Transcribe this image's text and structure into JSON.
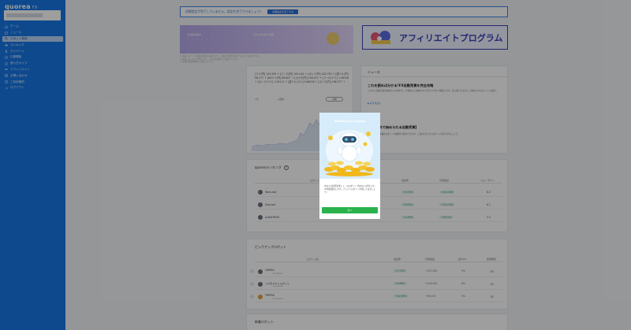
{
  "colors": {
    "sidebar": "#1877e6",
    "accent": "#2c6fd6",
    "modal_button": "#2bb24c",
    "affiliate": "#3b3fb5"
  },
  "sidebar": {
    "logo": "quorea",
    "logo_suffix": "FX",
    "items": [
      {
        "label": "ホーム",
        "icon": "home-icon"
      },
      {
        "label": "ニュース",
        "icon": "news-icon"
      },
      {
        "label": "ロボット検索",
        "icon": "search-icon",
        "active": true
      },
      {
        "label": "ランキング",
        "icon": "ranking-icon"
      },
      {
        "label": "マイページ",
        "icon": "user-icon"
      },
      {
        "label": "口座開設",
        "icon": "account-icon"
      },
      {
        "label": "使い方ガイド",
        "icon": "guide-icon"
      },
      {
        "label": "アフィリエイト",
        "icon": "affiliate-icon"
      },
      {
        "label": "お問い合わせ",
        "icon": "mail-icon"
      },
      {
        "label": "ご利用規約",
        "icon": "document-icon"
      },
      {
        "label": "ログアウト",
        "icon": "logout-icon"
      }
    ]
  },
  "banner": {
    "text": "初期設定が完了していません。設定を完了させましょう!",
    "button": "初期設定を完了する"
  },
  "promo": {
    "left_label": "全自動運用中",
    "left_value": "- - - - - -",
    "left_note": "月々の利用料が無料",
    "left_value2": "- - - - - - -",
    "affiliate_title": "アフィリエイトプログラム"
  },
  "notes": [
    "※ 掲載されている情報は過去の実績であり、将来の成果を保証するものではありません。",
    "※ 取引にはリスクが伴います。ご自身の判断でご利用ください。",
    "※ 詳細は各種規約をご確認ください。"
  ],
  "rates": {
    "text": "[ドル/円] 144.926 ↑ [ユーロ/円] 161.444 ↑ [ポンド/円] 182.765 ↑ [豪ドル/円] 96.277 ↑ [NZドル/円] 88.827 ↑ [カナダ/円] 106.071 ↑ [ユーロ/ドル] 1.08316 ↑ [ポンド/ドル] 1.26111 ↑ [豪ドル/ドル] 0.66456 ↑ [スイス/円] 166.377 ↑",
    "tabs": [
      "1日",
      "1週間"
    ],
    "button": "詳細"
  },
  "news": {
    "title": "ニュース",
    "items": [
      {
        "headline": "これを読めば分かる!FX自動売買を完全攻略",
        "body": "これから自動売買を始めたい方向けに、仕組みから始め方まで分かりやすく解説します。初心者でも安心して始められるポイントを紹介。",
        "link": "▶ 続きを読む"
      },
      {
        "headline": "【FX無料で始められる自動売買】",
        "body": "quoreaでは多数のロボットを無料で利用できます。ご自身に合ったロボットを見つけましょう。",
        "link": "▶ 続きを読む"
      }
    ]
  },
  "ranking": {
    "title": "quoreaランキング",
    "columns": [
      "ロボット名",
      "収益率",
      "月間損益",
      "ドローダウン"
    ],
    "rows": [
      {
        "name": "Tomo-bot",
        "v1": "+4.72%",
        "v2": "+112,000",
        "v3": "8.4"
      },
      {
        "name": "Sora-bot",
        "v1": "+3.55%",
        "v2": "+111,250",
        "v3": "6.1"
      },
      {
        "name": "ALBATROSS",
        "v1": "+2.89%",
        "v2": "+78,750",
        "v3": "5.5"
      }
    ]
  },
  "pickup": {
    "title": "ピックアップロボット",
    "columns": [
      "ロボット名",
      "収益率",
      "月間損益",
      "最大DD",
      "運用期間"
    ],
    "rows": [
      {
        "name": "CARIBU",
        "sub": "by Quorea",
        "v1": "+7.73%",
        "v2": "+152,000",
        "v3": "5%",
        "v4": "2年"
      },
      {
        "name": "ドル円スキャルボット",
        "sub": "by Quorea",
        "v1": "+4.98%",
        "v2": "+118,000",
        "v3": "8%",
        "v4": "1年"
      },
      {
        "name": "TRIPPLE",
        "sub": "by Quorea",
        "v1": "+11.94%",
        "v2": "+63,400",
        "v3": "4%",
        "v4": "2年"
      }
    ]
  },
  "new_robots": {
    "title": "新着ロボット"
  },
  "modal": {
    "welcome": "Welcome to quorea",
    "text": "あなたの投資を楽しく。AIロボットがあなたの代わりに24時間運用します。さっそくロボットを探してみましょう!",
    "button": "次へ"
  }
}
